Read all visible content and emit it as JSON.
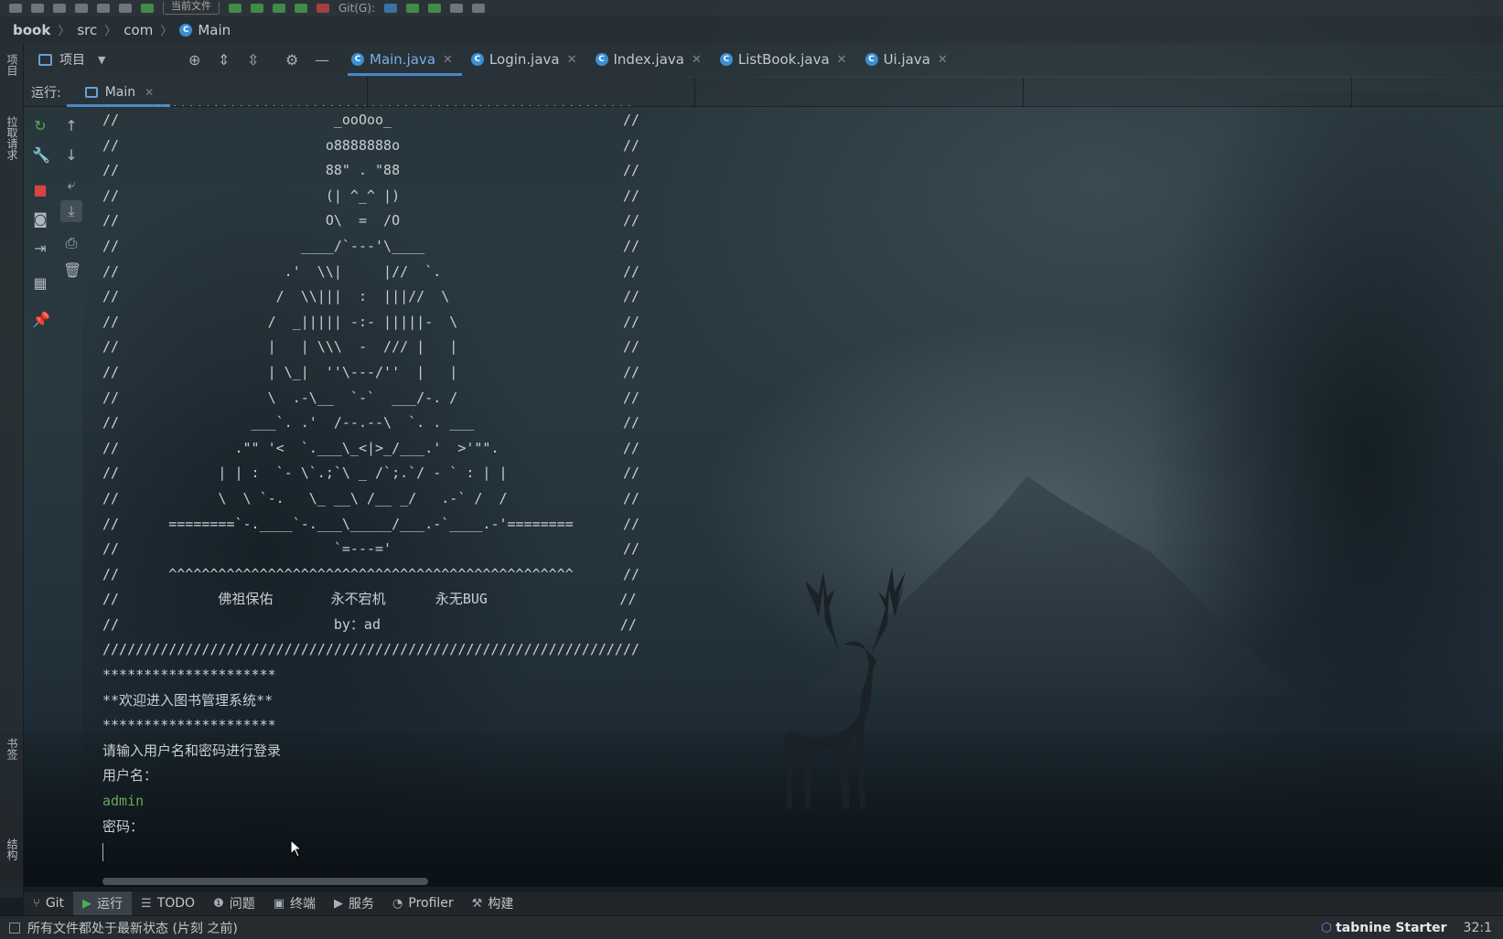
{
  "breadcrumb": {
    "items": [
      "book",
      "src",
      "com"
    ],
    "current": "Main"
  },
  "topbar": {
    "combo_label": "当前文件",
    "git_label": "Git(G):"
  },
  "left_strip": {
    "project": "项目",
    "pull_requests": "拉取请求",
    "bookmarks": "书签",
    "structure": "结构"
  },
  "project_panel": {
    "label": "项目"
  },
  "tabs": [
    {
      "label": "Main.java",
      "active": true
    },
    {
      "label": "Login.java",
      "active": false
    },
    {
      "label": "Index.java",
      "active": false
    },
    {
      "label": "ListBook.java",
      "active": false
    },
    {
      "label": "Ui.java",
      "active": false
    }
  ],
  "run": {
    "label": "运行:",
    "config": "Main"
  },
  "console": {
    "lines": [
      "//                          _ooOoo_                            //",
      "//                         o8888888o                           //",
      "//                         88\" . \"88                           //",
      "//                         (| ^_^ |)                           //",
      "//                         O\\  =  /O                           //",
      "//                      ____/`---'\\____                        //",
      "//                    .'  \\\\|     |//  `.                      //",
      "//                   /  \\\\|||  :  |||//  \\                     //",
      "//                  /  _||||| -:- |||||-  \\                    //",
      "//                  |   | \\\\\\  -  /// |   |                    //",
      "//                  | \\_|  ''\\---/''  |   |                    //",
      "//                  \\  .-\\__  `-`  ___/-. /                    //",
      "//                ___`. .'  /--.--\\  `. . ___                  //",
      "//              .\"\" '<  `.___\\_<|>_/___.'  >'\"\".               //",
      "//            | | :  `- \\`.;`\\ _ /`;.`/ - ` : | |              //",
      "//            \\  \\ `-.   \\_ __\\ /__ _/   .-` /  /              //",
      "//      ========`-.____`-.___\\_____/___.-`____.-'========      //",
      "//                          `=---='                            //",
      "//      ^^^^^^^^^^^^^^^^^^^^^^^^^^^^^^^^^^^^^^^^^^^^^^^^^      //",
      "//            佛祖保佑       永不宕机      永无BUG                //",
      "//                          by：ad                             //",
      "/////////////////////////////////////////////////////////////////",
      "*********************",
      "**欢迎进入图书管理系统**",
      "*********************",
      "请输入用户名和密码进行登录",
      "用户名：",
      "admin",
      "密码："
    ]
  },
  "bottom_tools": [
    {
      "label": "Git",
      "icon": "git-branch-icon",
      "active": false
    },
    {
      "label": "运行",
      "icon": "run-icon",
      "active": true
    },
    {
      "label": "TODO",
      "icon": "list-icon",
      "active": false
    },
    {
      "label": "问题",
      "icon": "problems-icon",
      "active": false
    },
    {
      "label": "终端",
      "icon": "terminal-icon",
      "active": false
    },
    {
      "label": "服务",
      "icon": "services-icon",
      "active": false
    },
    {
      "label": "Profiler",
      "icon": "profiler-icon",
      "active": false
    },
    {
      "label": "构建",
      "icon": "hammer-icon",
      "active": false
    }
  ],
  "status": {
    "message": "所有文件都处于最新状态 (片刻 之前)",
    "plugin": "tabnine Starter",
    "position": "32:1"
  },
  "colors": {
    "accent": "#4a88c7",
    "run_green": "#4caf50",
    "stop_red": "#d64541",
    "input_green": "#6aa84f"
  }
}
